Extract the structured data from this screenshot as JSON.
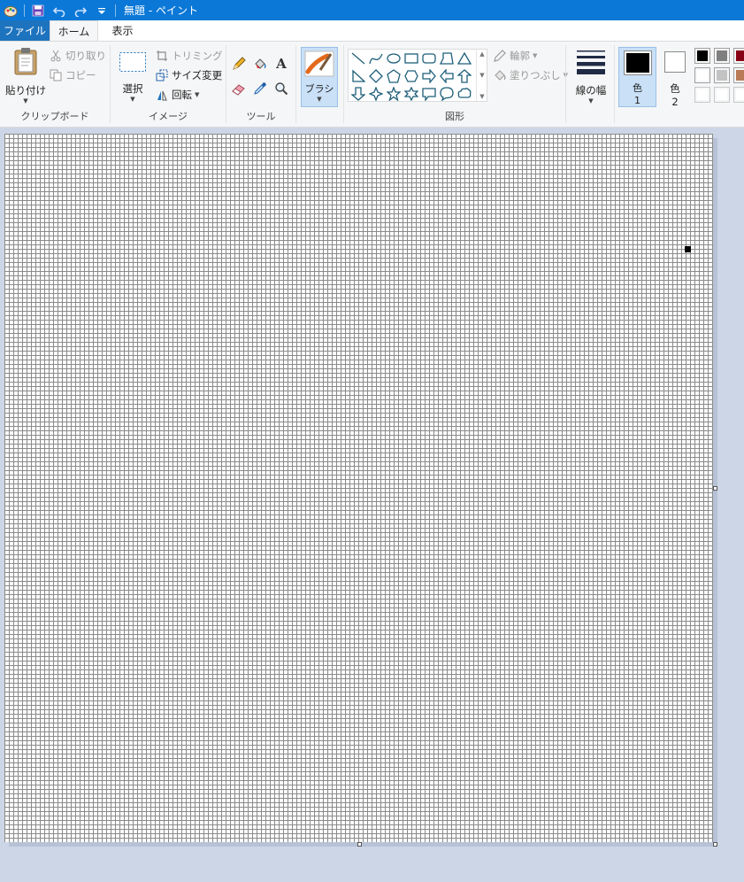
{
  "window": {
    "title": "無題 - ペイント"
  },
  "tabs": [
    {
      "label": "ファイル"
    },
    {
      "label": "ホーム"
    },
    {
      "label": "表示"
    }
  ],
  "clipboard": {
    "paste": "貼り付け",
    "cut": "切り取り",
    "copy": "コピー",
    "group_label": "クリップボード"
  },
  "image": {
    "select": "選択",
    "crop": "トリミング",
    "resize": "サイズ変更",
    "rotate": "回転",
    "group_label": "イメージ"
  },
  "tools": {
    "group_label": "ツール"
  },
  "brushes": {
    "label": "ブラシ"
  },
  "shapes": {
    "group_label": "図形",
    "outline": "輪郭",
    "fill": "塗りつぶし"
  },
  "size": {
    "label": "線の幅"
  },
  "colors": {
    "color1_label": "色",
    "color1_num": "1",
    "color2_label": "色",
    "color2_num": "2",
    "color1_value": "#000000",
    "color2_value": "#ffffff",
    "palette_row1": [
      "#000000",
      "#7f7f7f",
      "#880015"
    ],
    "palette_row2": [
      "#ffffff",
      "#c3c3c3",
      "#b97a57"
    ],
    "palette_row3": [
      "#ffffff",
      "#ffffff",
      "#ffffff"
    ]
  },
  "accent": "#0b78d7"
}
